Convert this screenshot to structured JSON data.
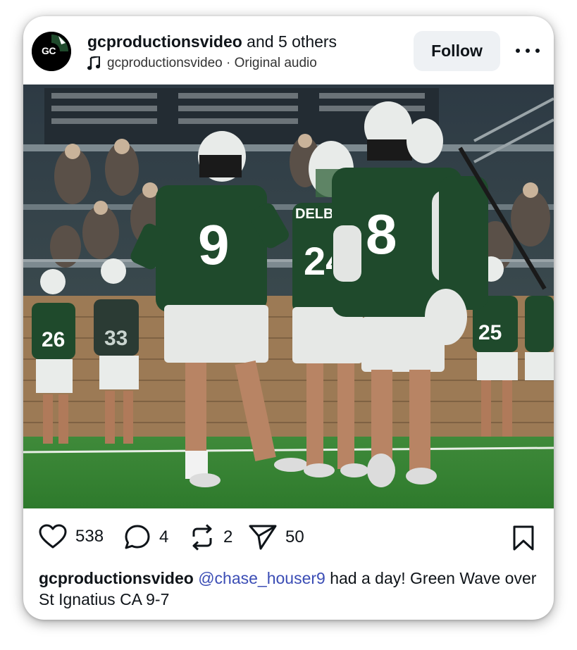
{
  "post": {
    "header": {
      "username": "gcproductionsvideo",
      "coauthors_text": " and 5 others",
      "avatar_text": "GC",
      "audio_author": "gcproductionsvideo",
      "audio_separator": " · ",
      "audio_title": "Original audio",
      "follow_label": "Follow"
    },
    "media": {
      "jersey_numbers": [
        "9",
        "24",
        "8",
        "26",
        "33",
        "25"
      ],
      "helmet_text": "DELBARTON"
    },
    "actions": {
      "likes": "538",
      "comments": "4",
      "reposts": "2",
      "shares": "50"
    },
    "caption": {
      "username": "gcproductionsvideo",
      "mention": "@chase_houser9",
      "text": " had a day! Green Wave over St Ignatius CA 9-7"
    }
  },
  "colors": {
    "jersey_green": "#1f4a2c",
    "mention_blue": "#3b4db5",
    "follow_bg": "#eef1f4"
  }
}
